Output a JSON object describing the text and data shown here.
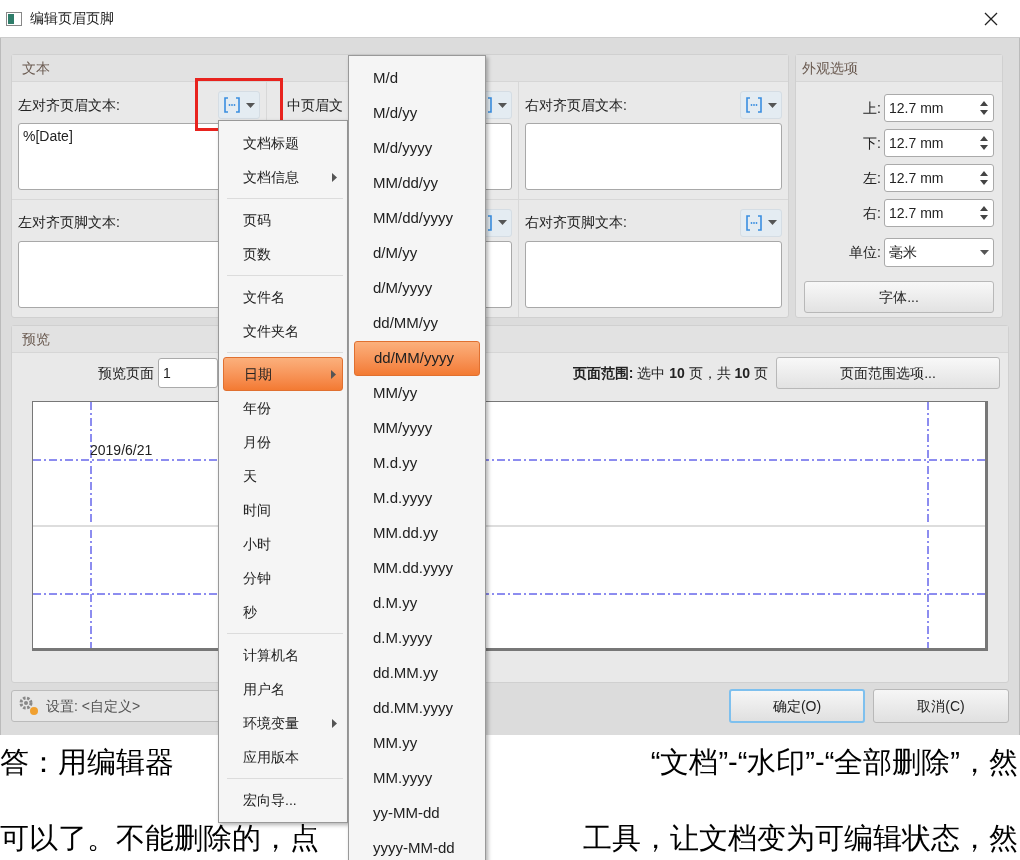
{
  "window": {
    "title": "编辑页眉页脚"
  },
  "text_group": {
    "title": "文本",
    "fields": [
      {
        "kind": "field",
        "label": "左对齐页眉文本:",
        "value": "%[Date]",
        "insert_button": true
      },
      {
        "kind": "field",
        "label": "中页眉文",
        "insert_button": true
      },
      {
        "kind": "field",
        "label": "右对齐页眉文本:",
        "insert_button": true
      },
      {
        "kind": "field",
        "label": "左对齐页脚文本:",
        "insert_button": false
      },
      {
        "kind": "field",
        "insert_button": true
      },
      {
        "kind": "field",
        "label": "右对齐页脚文本:",
        "insert_button": true
      }
    ]
  },
  "appearance": {
    "title": "外观选项",
    "margins": [
      {
        "label": "上:",
        "value": "12.7 mm"
      },
      {
        "label": "下:",
        "value": "12.7 mm"
      },
      {
        "label": "左:",
        "value": "12.7 mm"
      },
      {
        "label": "右:",
        "value": "12.7 mm"
      }
    ],
    "unit": {
      "label": "单位:",
      "value": "毫米"
    },
    "font_button": "字体..."
  },
  "preview": {
    "title": "预览",
    "page_label": "预览页面",
    "page_value": "1",
    "range_label": "**页面范围:** 选中 **10** 页，共 **10** 页",
    "range_button": "页面范围选项...",
    "sample_text": "2019/6/21"
  },
  "footer": {
    "settings": "设置: <自定义>",
    "buttons": [
      {
        "label": "确定(O)",
        "default": true
      },
      {
        "label": "取消(C)",
        "default": false
      }
    ]
  },
  "insert_menu": {
    "items": [
      {
        "kind": "item",
        "label": "文档标题",
        "submenu": false,
        "selected": false
      },
      {
        "kind": "item",
        "label": "文档信息",
        "submenu": true,
        "selected": false
      },
      {
        "kind": "separator"
      },
      {
        "kind": "item",
        "label": "页码",
        "submenu": false,
        "selected": false
      },
      {
        "kind": "item",
        "label": "页数",
        "submenu": false,
        "selected": false
      },
      {
        "kind": "separator"
      },
      {
        "kind": "item",
        "label": "文件名",
        "submenu": false,
        "selected": false
      },
      {
        "kind": "item",
        "label": "文件夹名",
        "submenu": false,
        "selected": false
      },
      {
        "kind": "separator"
      },
      {
        "kind": "item",
        "label": "日期",
        "submenu": true,
        "selected": true
      },
      {
        "kind": "item",
        "label": "年份",
        "submenu": false,
        "selected": false
      },
      {
        "kind": "item",
        "label": "月份",
        "submenu": false,
        "selected": false
      },
      {
        "kind": "item",
        "label": "天",
        "submenu": false,
        "selected": false
      },
      {
        "kind": "item",
        "label": "时间",
        "submenu": false,
        "selected": false
      },
      {
        "kind": "item",
        "label": "小时",
        "submenu": false,
        "selected": false
      },
      {
        "kind": "item",
        "label": "分钟",
        "submenu": false,
        "selected": false
      },
      {
        "kind": "item",
        "label": "秒",
        "submenu": false,
        "selected": false
      },
      {
        "kind": "separator"
      },
      {
        "kind": "item",
        "label": "计算机名",
        "submenu": false,
        "selected": false
      },
      {
        "kind": "item",
        "label": "用户名",
        "submenu": false,
        "selected": false
      },
      {
        "kind": "item",
        "label": "环境变量",
        "submenu": true,
        "selected": false
      },
      {
        "kind": "item",
        "label": "应用版本",
        "submenu": false,
        "selected": false
      },
      {
        "kind": "separator"
      },
      {
        "kind": "item",
        "label": "宏向导...",
        "submenu": false,
        "selected": false
      }
    ]
  },
  "date_menu": {
    "items": [
      {
        "label": "M/d",
        "selected": false
      },
      {
        "label": "M/d/yy",
        "selected": false
      },
      {
        "label": "M/d/yyyy",
        "selected": false
      },
      {
        "label": "MM/dd/yy",
        "selected": false
      },
      {
        "label": "MM/dd/yyyy",
        "selected": false
      },
      {
        "label": "d/M/yy",
        "selected": false
      },
      {
        "label": "d/M/yyyy",
        "selected": false
      },
      {
        "label": "dd/MM/yy",
        "selected": false
      },
      {
        "label": "dd/MM/yyyy",
        "selected": true
      },
      {
        "label": "MM/yy",
        "selected": false
      },
      {
        "label": "MM/yyyy",
        "selected": false
      },
      {
        "label": "M.d.yy",
        "selected": false
      },
      {
        "label": "M.d.yyyy",
        "selected": false
      },
      {
        "label": "MM.dd.yy",
        "selected": false
      },
      {
        "label": "MM.dd.yyyy",
        "selected": false
      },
      {
        "label": "d.M.yy",
        "selected": false
      },
      {
        "label": "d.M.yyyy",
        "selected": false
      },
      {
        "label": "dd.MM.yy",
        "selected": false
      },
      {
        "label": "dd.MM.yyyy",
        "selected": false
      },
      {
        "label": "MM.yy",
        "selected": false
      },
      {
        "label": "MM.yyyy",
        "selected": false
      },
      {
        "label": "yy-MM-dd",
        "selected": false
      },
      {
        "label": "yyyy-MM-dd",
        "selected": false
      }
    ]
  },
  "page_text": {
    "lines": [
      {
        "left": "答：用编辑器",
        "right": "“文档”-“水印”-“全部删除”，然"
      },
      {
        "left": "可以了。不能删除的，点",
        "right": "工具，让文档变为可编辑状态，然"
      }
    ]
  }
}
